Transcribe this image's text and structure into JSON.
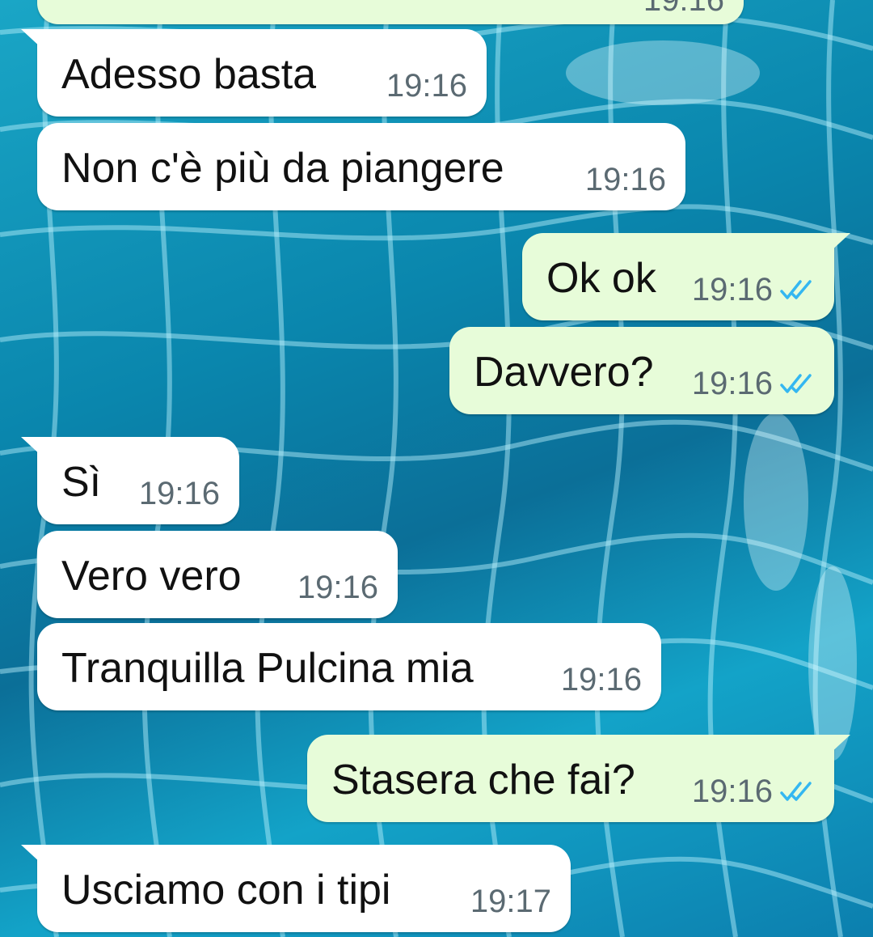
{
  "colors": {
    "incoming_bubble": "#ffffff",
    "outgoing_bubble": "#e7fcd9",
    "text": "#111111",
    "timestamp": "#5b6a72",
    "read_ticks": "#34b7f1"
  },
  "partial_top": {
    "time": "19:16"
  },
  "messages": [
    {
      "direction": "in",
      "text": "Adesso basta",
      "time": "19:16"
    },
    {
      "direction": "in",
      "text": "Non c'è più da piangere",
      "time": "19:16"
    },
    {
      "direction": "out",
      "text": "Ok ok",
      "time": "19:16",
      "status_icon": "double-check-icon"
    },
    {
      "direction": "out",
      "text": "Davvero?",
      "time": "19:16",
      "status_icon": "double-check-icon"
    },
    {
      "direction": "in",
      "text": "Sì",
      "time": "19:16"
    },
    {
      "direction": "in",
      "text": "Vero vero",
      "time": "19:16"
    },
    {
      "direction": "in",
      "text": "Tranquilla Pulcina mia",
      "time": "19:16"
    },
    {
      "direction": "out",
      "text": "Stasera che fai?",
      "time": "19:16",
      "status_icon": "double-check-icon"
    },
    {
      "direction": "in",
      "text": "Usciamo con i tipi",
      "time": "19:17"
    }
  ]
}
